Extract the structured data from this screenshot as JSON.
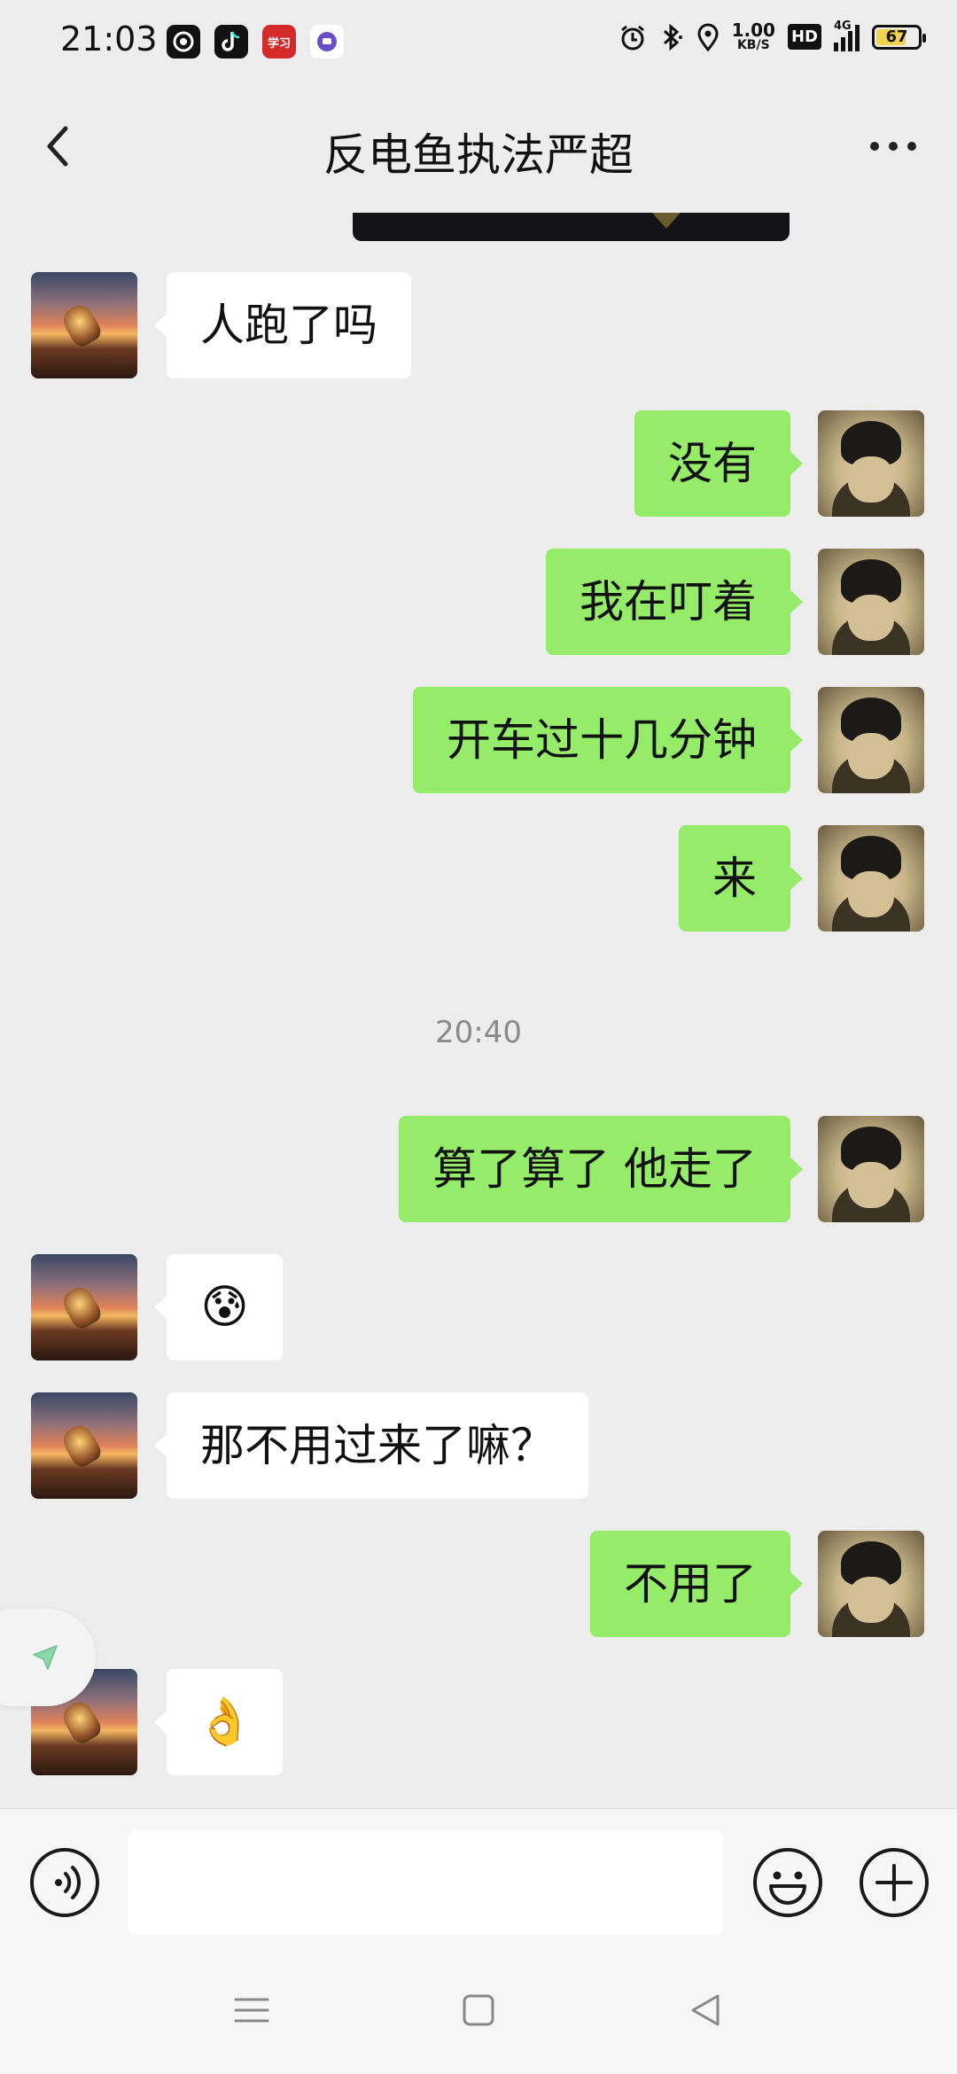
{
  "status_bar": {
    "time": "21:03",
    "network_speed_value": "1.00",
    "network_speed_unit": "KB/S",
    "hd_label": "HD",
    "network_type": "4G",
    "battery": "67",
    "apps": [
      {
        "name": "zhihu-app-icon",
        "glyph": "◎",
        "color": "#111111"
      },
      {
        "name": "douyin-app-icon",
        "glyph": "♪",
        "color": "#111111"
      },
      {
        "name": "xuexi-app-icon",
        "glyph": "学习",
        "color": "#d42a2a"
      },
      {
        "name": "message-app-icon",
        "glyph": "●",
        "color": "#ffffff"
      }
    ]
  },
  "header": {
    "title": "反电鱼执法严超"
  },
  "messages": [
    {
      "side": "left",
      "text": "人跑了吗"
    },
    {
      "side": "right",
      "text": "没有"
    },
    {
      "side": "right",
      "text": "我在叮着"
    },
    {
      "side": "right",
      "text": "开车过十几分钟"
    },
    {
      "side": "right",
      "text": "来"
    },
    {
      "side": "right",
      "text": "算了算了 他走了"
    },
    {
      "side": "left",
      "text": "😰"
    },
    {
      "side": "left",
      "text": "那不用过来了嘛？"
    },
    {
      "side": "right",
      "text": "不用了"
    },
    {
      "side": "left",
      "text": "👌"
    }
  ],
  "timestamp": "20:40",
  "input": {
    "placeholder": "",
    "value": ""
  },
  "colors": {
    "background": "#ededed",
    "sent_bubble": "#95ec69",
    "received_bubble": "#ffffff",
    "timestamp_text": "#8a8a8a"
  }
}
